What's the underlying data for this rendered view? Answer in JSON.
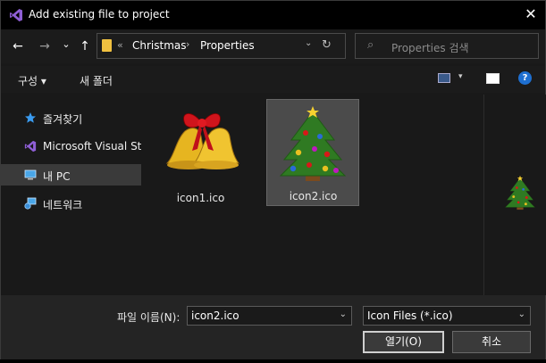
{
  "window": {
    "title": "Add existing file to project",
    "close_glyph": "✕"
  },
  "nav": {
    "back_glyph": "←",
    "forward_glyph": "→",
    "recent_glyph": "⌄",
    "up_glyph": "↑",
    "overflow_glyph": "«",
    "crumb_sep": "›",
    "crumbs": [
      "Christmas",
      "Properties"
    ],
    "refresh_glyph": "↻",
    "dropdown_glyph": "⌄",
    "search_placeholder": "Properties 검색",
    "search_glyph": "⌕"
  },
  "commands": {
    "organize": "구성 ▾",
    "new_folder": "새 폴더",
    "help_glyph": "?",
    "view_dropdown_glyph": "▾"
  },
  "sidebar": {
    "items": [
      {
        "label": "즐겨찾기",
        "icon": "star-icon"
      },
      {
        "label": "Microsoft Visual Studio",
        "icon": "visual-studio-icon"
      },
      {
        "label": "내 PC",
        "icon": "computer-icon",
        "selected": true
      },
      {
        "label": "네트워크",
        "icon": "network-icon"
      }
    ]
  },
  "files": [
    {
      "name": "icon1.ico",
      "icon": "bells-icon",
      "selected": false
    },
    {
      "name": "icon2.ico",
      "icon": "christmas-tree-icon",
      "selected": true
    }
  ],
  "footer": {
    "filename_label": "파일 이름(N):",
    "filename_value": "icon2.ico",
    "filter_value": "Icon Files (*.ico)",
    "open_label": "열기(O)",
    "cancel_label": "취소",
    "combo_arrow": "⌄"
  },
  "colors": {
    "accent_vs": "#8f5fd6",
    "selection": "#4b4b4b",
    "help_blue": "#1e6fd0"
  }
}
